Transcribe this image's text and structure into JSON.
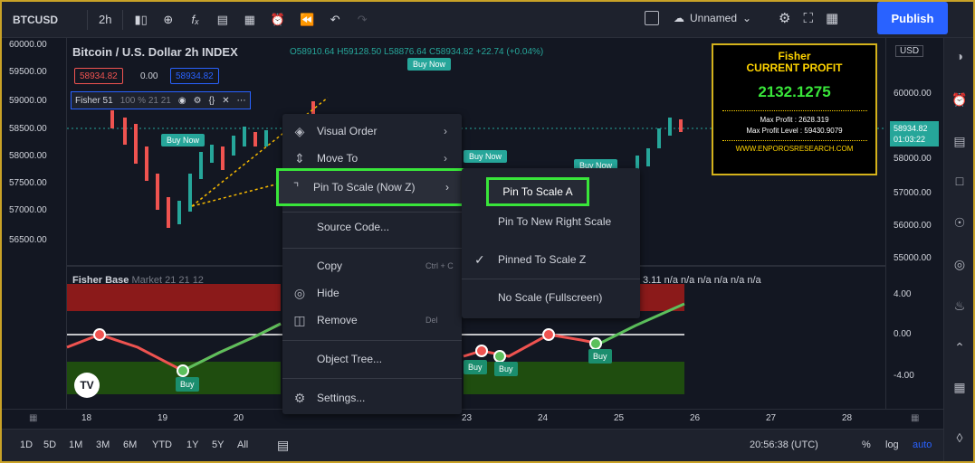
{
  "topbar": {
    "symbol": "BTCUSD",
    "interval": "2h",
    "layout_name": "Unnamed",
    "publish_label": "Publish"
  },
  "legend": {
    "title": "Bitcoin / U.S. Dollar  2h  INDEX",
    "ohlc": "O58910.64 H59128.50 L58876.64 C58934.82 +22.74 (+0.04%)",
    "sell_price": "58934.82",
    "spread": "0.00",
    "buy_price": "58934.82"
  },
  "indicator": {
    "name": "Fisher 51",
    "params": "100 % 21 21"
  },
  "left_axis": [
    "60000.00",
    "59500.00",
    "59000.00",
    "58500.00",
    "58000.00",
    "57500.00",
    "57000.00",
    "56500.00"
  ],
  "right_axis": [
    "USD",
    "60000.00",
    "58934.82",
    "01:03:22",
    "58000.00",
    "57000.00",
    "56000.00",
    "55000.00",
    "4.00",
    "0.00",
    "-4.00"
  ],
  "buy_tags": [
    "Buy Now",
    "Buy Now",
    "Buy Now",
    "Buy Now"
  ],
  "sub_indicator": {
    "name": "Fisher Base",
    "params": "Market 21 21 12",
    "na_values": "3.11 n/a n/a n/a n/a n/a n/a",
    "buy_labels": [
      "Buy",
      "Buy",
      "Buy",
      "Buy"
    ]
  },
  "context_menu": {
    "items": [
      "Visual Order",
      "Move To",
      "Pin To Scale (Now Z)",
      "Source Code...",
      "Copy",
      "Hide",
      "Remove",
      "Object Tree...",
      "Settings..."
    ],
    "copy_shortcut": "Ctrl + C",
    "remove_shortcut": "Del"
  },
  "submenu": {
    "items": [
      "Pin To Scale A",
      "Pin To New Right Scale",
      "Pinned To Scale Z",
      "No Scale (Fullscreen)"
    ]
  },
  "profit_box": {
    "title": "Fisher",
    "subtitle": "CURRENT PROFIT",
    "value": "2132.1275",
    "max_profit": "Max Profit : 2628.319",
    "max_profit_level": "Max Profit Level : 59430.9079",
    "url": "WWW.ENPOROSRESEARCH.COM"
  },
  "time_axis": [
    "18",
    "19",
    "20",
    "23",
    "24",
    "25",
    "26",
    "27",
    "28"
  ],
  "bottombar": {
    "ranges": [
      "1D",
      "5D",
      "1M",
      "3M",
      "6M",
      "YTD",
      "1Y",
      "5Y",
      "All"
    ],
    "clock": "20:56:38 (UTC)",
    "percent": "%",
    "log": "log",
    "auto": "auto"
  },
  "colors": {
    "background": "#131722",
    "accent": "#2962ff",
    "highlight_border": "#39e63a",
    "up": "#26a69a",
    "down": "#ef5350",
    "profit_border": "#d4b21b"
  }
}
